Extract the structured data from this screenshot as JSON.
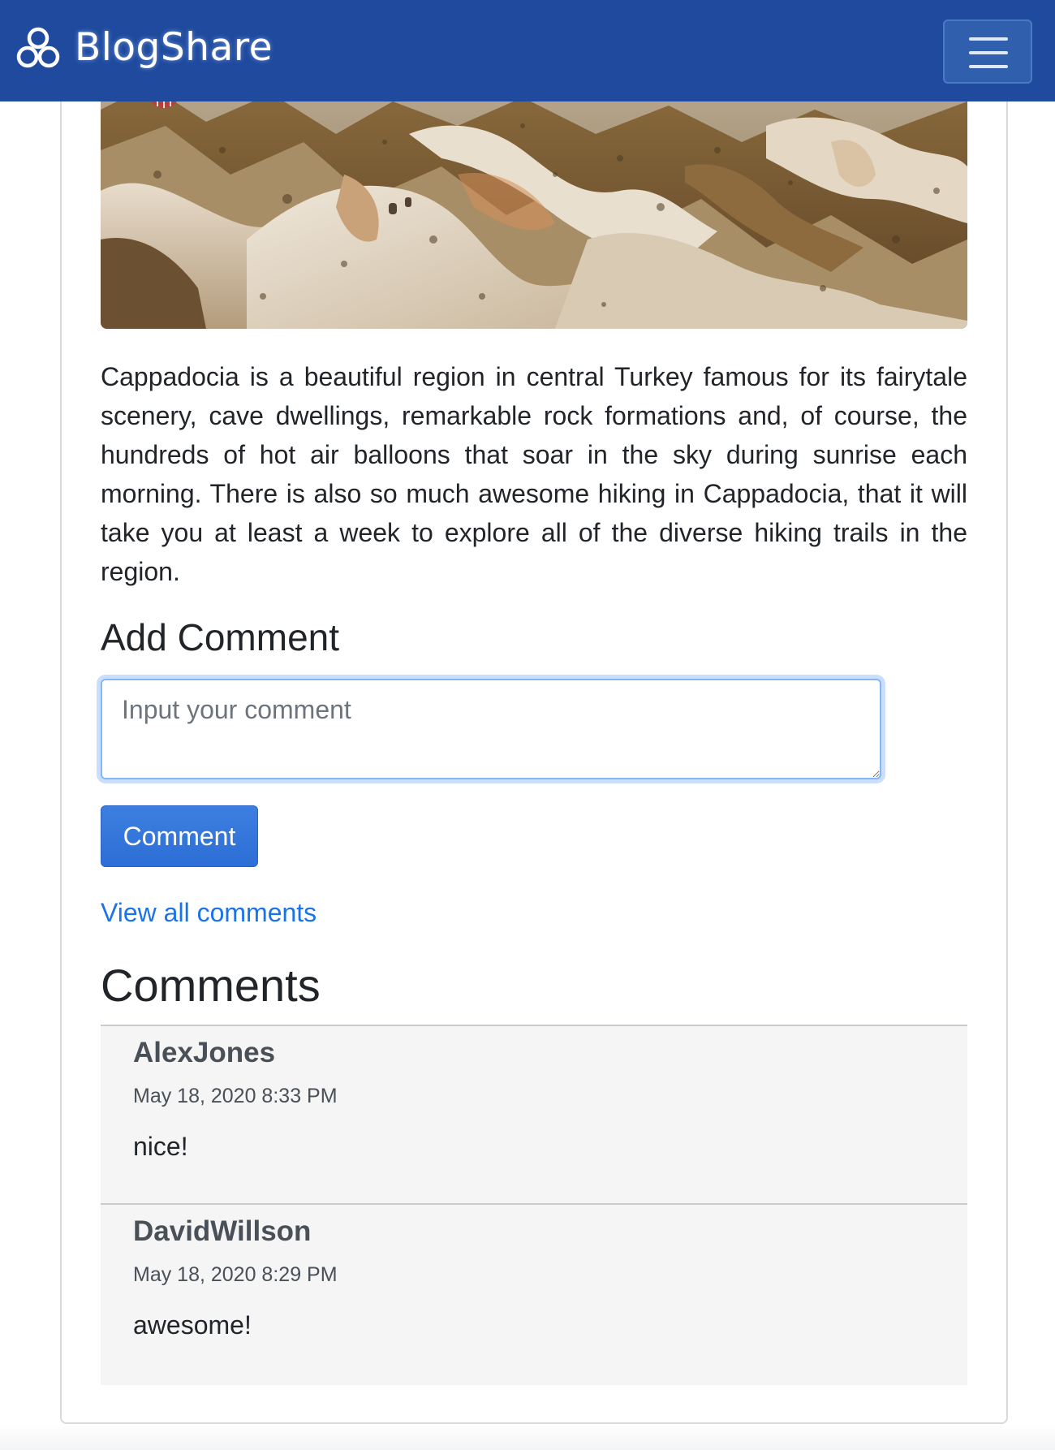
{
  "navbar": {
    "brand": "BlogShare",
    "logo_icon": "circles-logo-icon",
    "menu_icon": "hamburger-menu-icon",
    "background": "#1f4a9e"
  },
  "post": {
    "image_icon": "landscape-photo",
    "body": "Cappadocia is a beautiful region in central Turkey famous for its fairytale scenery, cave dwellings, remarkable rock formations and, of course, the hundreds of hot air balloons that soar in the sky during sunrise each morning. There is also so much awesome hiking in Cappadocia, that it will take you at least a week to explore all of the diverse hiking trails in the region."
  },
  "add_comment": {
    "heading": "Add Comment",
    "placeholder": "Input your comment",
    "value": "",
    "button_label": "Comment",
    "button_color": "#2d6ed6"
  },
  "view_all_label": "View all comments",
  "comments": {
    "heading": "Comments",
    "items": [
      {
        "author": "AlexJones",
        "date": "May 18, 2020 8:33 PM",
        "text": "nice!"
      },
      {
        "author": "DavidWillson",
        "date": "May 18, 2020 8:29 PM",
        "text": "awesome!"
      }
    ]
  }
}
